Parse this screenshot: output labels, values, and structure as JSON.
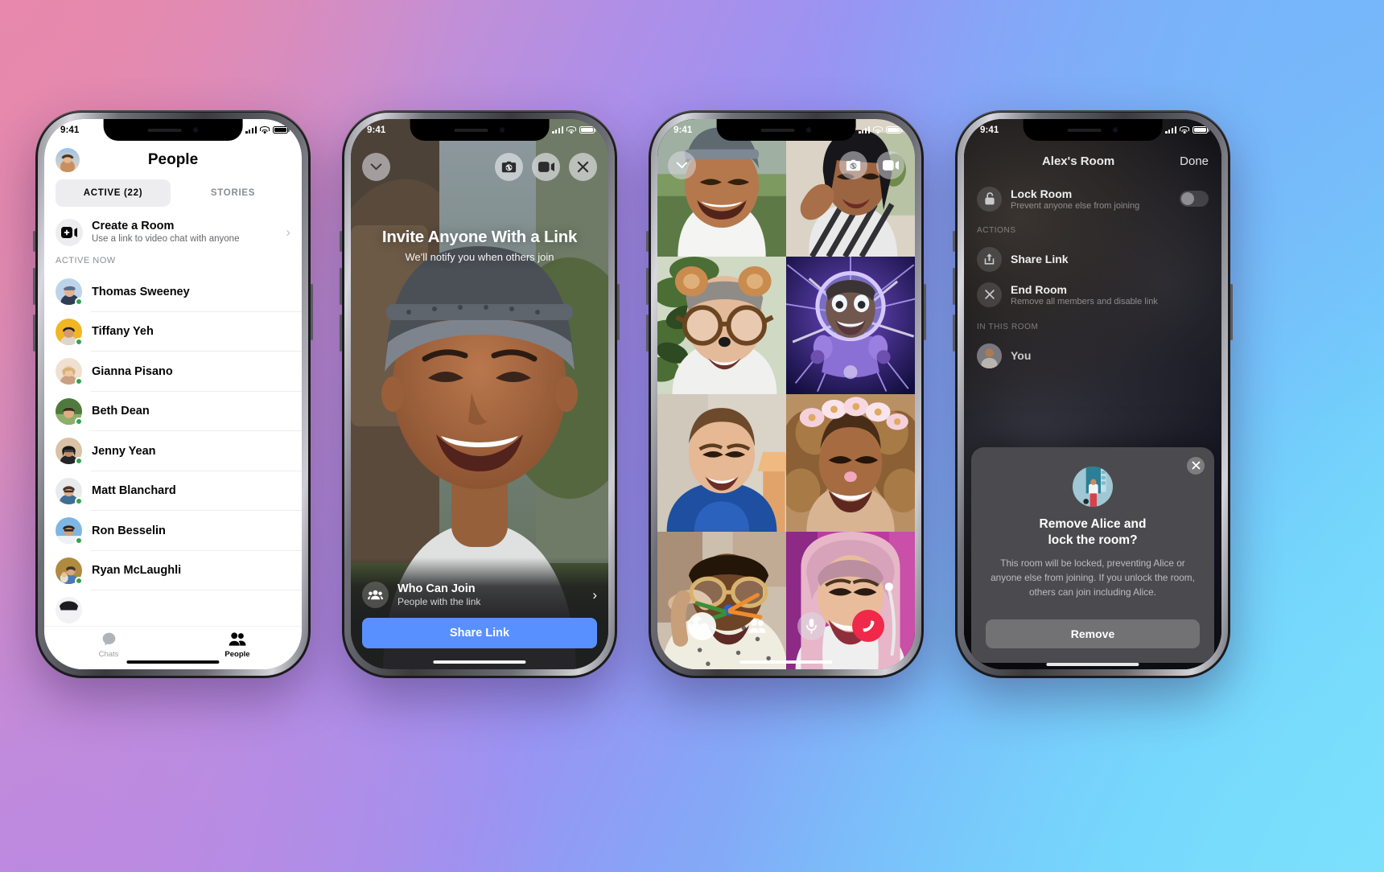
{
  "background": {
    "gradient_from": "#e58aae",
    "gradient_mid": "#9a93f2",
    "gradient_to": "#77e0fc"
  },
  "phones": [
    {
      "id": "people-list",
      "status_bar": {
        "time": "9:41",
        "signal_icon": "cellular-bars-icon",
        "wifi_icon": "wifi-icon",
        "battery_icon": "battery-icon"
      },
      "header": {
        "title": "People",
        "avatar_icon": "user-avatar"
      },
      "tabs": [
        {
          "label": "ACTIVE (22)",
          "active": true
        },
        {
          "label": "STORIES",
          "active": false
        }
      ],
      "create_room": {
        "icon": "video-plus-icon",
        "title": "Create a Room",
        "subtitle": "Use a link to video chat with anyone",
        "chevron": "chevron-right-icon"
      },
      "section_label": "ACTIVE NOW",
      "contacts": [
        {
          "name": "Thomas Sweeney",
          "online": true
        },
        {
          "name": "Tiffany Yeh",
          "online": true
        },
        {
          "name": "Gianna Pisano",
          "online": true
        },
        {
          "name": "Beth Dean",
          "online": true
        },
        {
          "name": "Jenny Yean",
          "online": true
        },
        {
          "name": "Matt Blanchard",
          "online": true
        },
        {
          "name": "Ron Besselin",
          "online": true
        },
        {
          "name": "Ryan McLaughli",
          "online": true
        }
      ],
      "tab_bar": [
        {
          "label": "Chats",
          "icon": "chat-bubble-icon",
          "selected": false
        },
        {
          "label": "People",
          "icon": "people-icon",
          "selected": true
        }
      ]
    },
    {
      "id": "invite-link",
      "status_bar": {
        "time": "9:41"
      },
      "controls": {
        "collapse_icon": "chevron-down-icon",
        "flip_camera_icon": "camera-flip-icon",
        "video_icon": "video-camera-icon",
        "close_icon": "close-icon"
      },
      "hero": {
        "title": "Invite Anyone With a Link",
        "subtitle": "We'll notify you when others join"
      },
      "who_can_join": {
        "icon": "people-group-icon",
        "title": "Who Can Join",
        "subtitle": "People with the link",
        "chevron": "chevron-right-icon"
      },
      "share_button": {
        "label": "Share Link",
        "color": "#5890ff"
      }
    },
    {
      "id": "group-call-grid",
      "status_bar": {
        "time": "9:41"
      },
      "controls": {
        "collapse_icon": "chevron-down-icon",
        "flip_camera_icon": "camera-flip-icon",
        "video_icon": "video-camera-icon",
        "shutter_icon": "capture-shutter-icon",
        "participants_icon": "people-icon",
        "mic_icon": "microphone-icon",
        "end_call_icon": "end-call-icon",
        "end_call_color": "#f02849"
      },
      "participant_count": 8
    },
    {
      "id": "room-settings",
      "status_bar": {
        "time": "9:41"
      },
      "nav": {
        "title": "Alex's Room",
        "done_label": "Done"
      },
      "lock_room": {
        "icon": "lock-open-icon",
        "title": "Lock Room",
        "subtitle": "Prevent anyone else from joining",
        "toggle_on": false
      },
      "actions_label": "ACTIONS",
      "actions": [
        {
          "icon": "share-icon",
          "title": "Share Link",
          "subtitle": ""
        },
        {
          "icon": "close-circle-icon",
          "title": "End Room",
          "subtitle": "Remove all members and disable link"
        }
      ],
      "in_room_label": "IN THIS ROOM",
      "members": [
        {
          "name": "You"
        }
      ],
      "dialog": {
        "close_icon": "close-icon",
        "avatar_icon": "member-avatar",
        "title_line1": "Remove Alice and",
        "title_line2": "lock the room?",
        "body": "This room will be locked, preventing Alice or anyone else from joining. If you unlock the room, others can join including Alice.",
        "confirm_label": "Remove"
      }
    }
  ]
}
